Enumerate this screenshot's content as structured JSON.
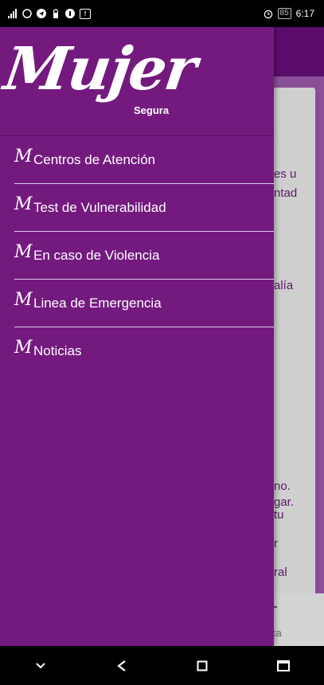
{
  "status_bar": {
    "time": "6:17",
    "battery": "85",
    "network": "4G",
    "icons": [
      "signal-icon",
      "whatsapp-icon",
      "telegram-icon",
      "lock-icon",
      "notification-icon",
      "facebook-icon",
      "alarm-icon",
      "battery-icon"
    ]
  },
  "drawer": {
    "logo_title": "Mujer",
    "logo_subtitle": "Segura",
    "menu_icon_glyph": "M",
    "items": [
      {
        "label": "Centros de Atención"
      },
      {
        "label": "Test de Vulnerabilidad"
      },
      {
        "label": "En caso de Violencia"
      },
      {
        "label": "Linea de Emergencia"
      },
      {
        "label": "Noticias"
      }
    ]
  },
  "background_content": {
    "lines": [
      "es u",
      "ntad",
      "alía",
      "no.",
      "gar.",
      "tu",
      "r",
      "ral"
    ],
    "bottom_text": "ca"
  },
  "colors": {
    "drawer": "#741a7f",
    "header": "#5b0d6c",
    "card": "#cfcfcf"
  }
}
